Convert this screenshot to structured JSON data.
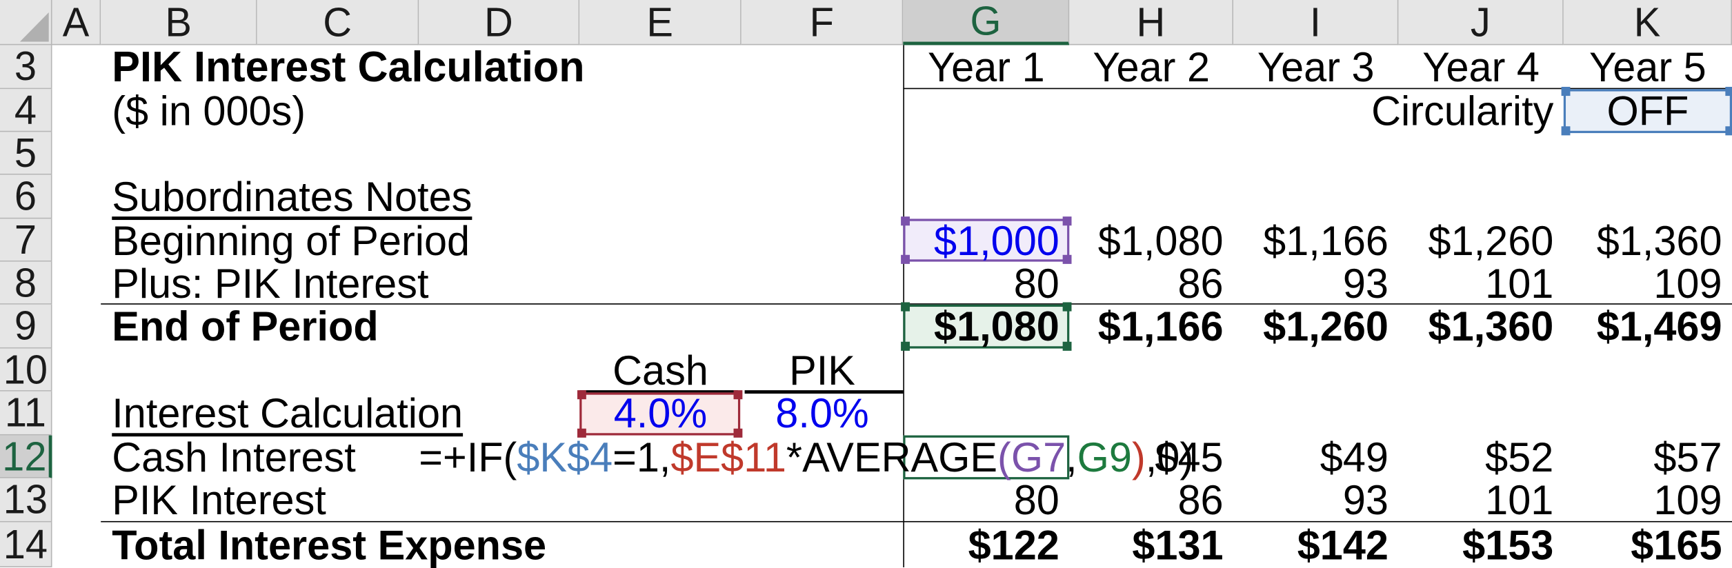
{
  "grid": {
    "column_headers": [
      "A",
      "B",
      "C",
      "D",
      "E",
      "F",
      "G",
      "H",
      "I",
      "J",
      "K"
    ],
    "selected_column": "G",
    "row_headers": [
      "3",
      "4",
      "5",
      "6",
      "7",
      "8",
      "9",
      "10",
      "11",
      "12",
      "13",
      "14"
    ],
    "selected_row": "12",
    "active_cell": "G12"
  },
  "colors": {
    "selection_green": "#1d6340",
    "ref_purple": "#7b52ab",
    "ref_red": "#9e2a3a",
    "ref_blue": "#4a7ebb",
    "input_blue": "#0000ee",
    "header_gray": "#e6e6e6"
  },
  "title": {
    "heading": "PIK Interest Calculation",
    "units": "($ in 000s)"
  },
  "years": [
    "Year 1",
    "Year 2",
    "Year 3",
    "Year 4",
    "Year 5"
  ],
  "circularity": {
    "label": "Circularity",
    "value": "OFF"
  },
  "sections": {
    "sub_notes_title": "Subordinates Notes",
    "interest_calc_title": "Interest Calculation"
  },
  "rows": {
    "beginning_of_period": {
      "label": "Beginning of Period",
      "values": [
        "$1,000",
        "$1,080",
        "$1,166",
        "$1,260",
        "$1,360"
      ]
    },
    "plus_pik_interest": {
      "label": "Plus: PIK Interest",
      "values": [
        "80",
        "86",
        "93",
        "101",
        "109"
      ]
    },
    "end_of_period": {
      "label": "End of Period",
      "values": [
        "$1,080",
        "$1,166",
        "$1,260",
        "$1,360",
        "$1,469"
      ]
    },
    "cash_interest": {
      "label": "Cash Interest",
      "values": [
        "",
        "$45",
        "$49",
        "$52",
        "$57"
      ]
    },
    "pik_interest": {
      "label": "PIK Interest",
      "values": [
        "80",
        "86",
        "93",
        "101",
        "109"
      ]
    },
    "total_interest_expense": {
      "label": "Total Interest Expense",
      "values": [
        "$122",
        "$131",
        "$142",
        "$153",
        "$165"
      ]
    }
  },
  "rate_headers": {
    "cash": "Cash",
    "pik": "PIK"
  },
  "rates": {
    "cash_rate": "4.0%",
    "pik_rate": "8.0%"
  },
  "formula": {
    "full": "=+IF($K$4=1,$E$11*AVERAGE(G7,G9),0)",
    "part_prefix": "=+IF(",
    "part_k4": "$K$4",
    "part_eq1": "=1,",
    "part_e11": "$E$11",
    "part_mul": "*AVERAGE",
    "part_open": "(",
    "part_g7": "G7",
    "part_comma": ",",
    "part_g9": "G9",
    "part_close": ")",
    "part_zero": ",0)"
  }
}
